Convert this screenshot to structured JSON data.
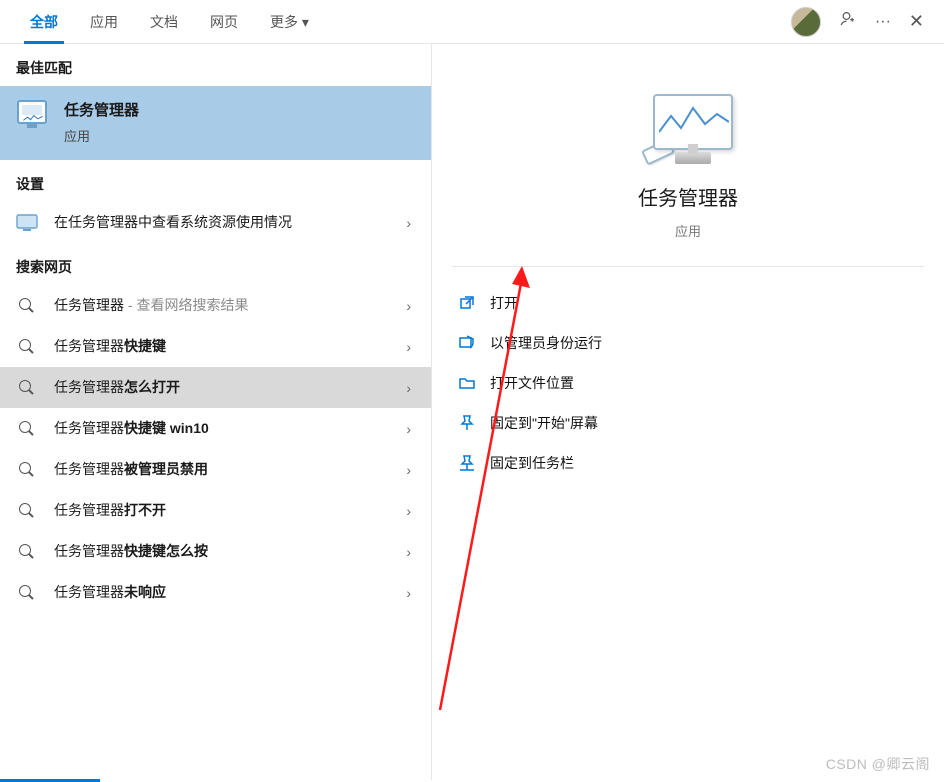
{
  "tabs": {
    "items": [
      {
        "label": "全部",
        "active": true
      },
      {
        "label": "应用",
        "active": false
      },
      {
        "label": "文档",
        "active": false
      },
      {
        "label": "网页",
        "active": false
      },
      {
        "label": "更多 ▾",
        "active": false
      }
    ]
  },
  "left": {
    "best_match_label": "最佳匹配",
    "best_match": {
      "title": "任务管理器",
      "subtitle": "应用"
    },
    "settings_label": "设置",
    "settings_item": "在任务管理器中查看系统资源使用情况",
    "web_label": "搜索网页",
    "web_items": [
      {
        "pre": "任务管理器",
        "bold": "",
        "suffix": " - 查看网络搜索结果",
        "hover": false
      },
      {
        "pre": "任务管理器",
        "bold": "快捷键",
        "suffix": "",
        "hover": false
      },
      {
        "pre": "任务管理器",
        "bold": "怎么打开",
        "suffix": "",
        "hover": true
      },
      {
        "pre": "任务管理器",
        "bold": "快捷键 win10",
        "suffix": "",
        "hover": false
      },
      {
        "pre": "任务管理器",
        "bold": "被管理员禁用",
        "suffix": "",
        "hover": false
      },
      {
        "pre": "任务管理器",
        "bold": "打不开",
        "suffix": "",
        "hover": false
      },
      {
        "pre": "任务管理器",
        "bold": "快捷键怎么按",
        "suffix": "",
        "hover": false
      },
      {
        "pre": "任务管理器",
        "bold": "未响应",
        "suffix": "",
        "hover": false
      }
    ],
    "chevron": "›"
  },
  "right": {
    "title": "任务管理器",
    "subtitle": "应用",
    "actions": [
      {
        "icon": "open-icon",
        "label": "打开"
      },
      {
        "icon": "admin-icon",
        "label": "以管理员身份运行"
      },
      {
        "icon": "folder-icon",
        "label": "打开文件位置"
      },
      {
        "icon": "pin-start-icon",
        "label": "固定到\"开始\"屏幕"
      },
      {
        "icon": "pin-taskbar-icon",
        "label": "固定到任务栏"
      }
    ]
  },
  "watermark": "CSDN @卿云阁"
}
